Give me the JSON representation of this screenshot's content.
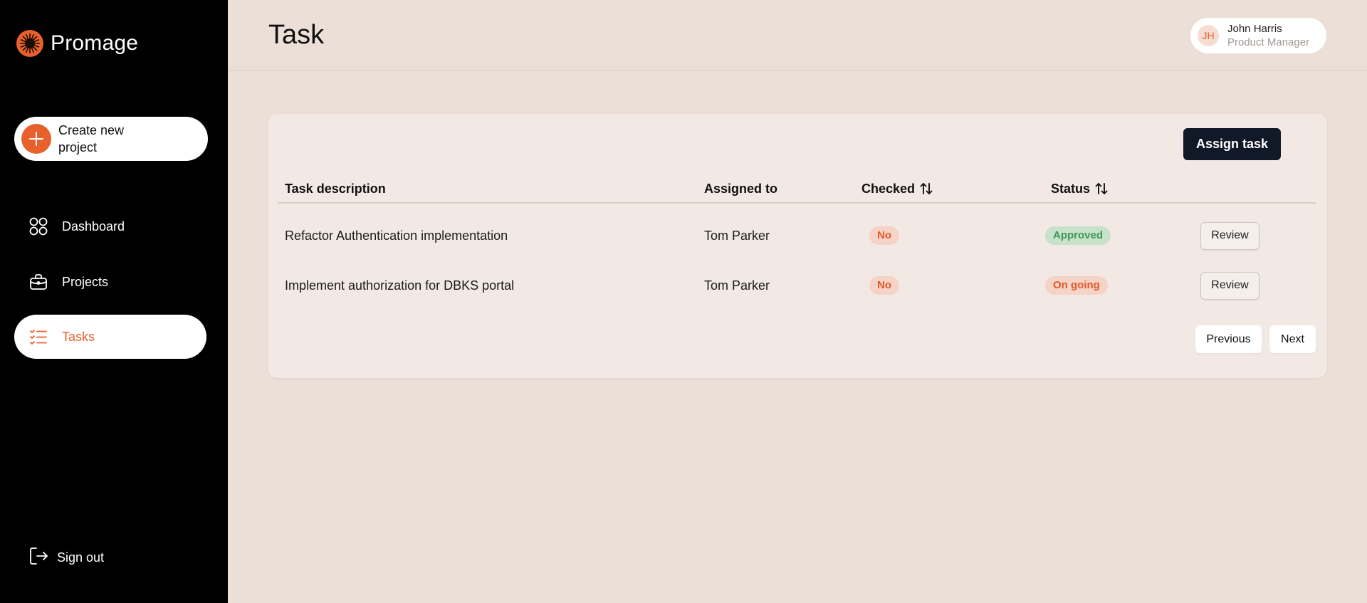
{
  "brand": {
    "name": "Promage",
    "logo_icon": "sunburst-logo",
    "accent": "#e8602c"
  },
  "sidebar": {
    "create_button": {
      "label": "Create new project",
      "icon": "plus-icon"
    },
    "items": [
      {
        "label": "Dashboard",
        "icon": "grid-icon",
        "active": false
      },
      {
        "label": "Projects",
        "icon": "briefcase-icon",
        "active": false
      },
      {
        "label": "Tasks",
        "icon": "checklist-icon",
        "active": true
      }
    ],
    "signout": {
      "label": "Sign out",
      "icon": "logout-icon"
    }
  },
  "header": {
    "title": "Task",
    "user": {
      "initials": "JH",
      "name": "John Harris",
      "role": "Product Manager"
    }
  },
  "tasks": {
    "assign_button": "Assign task",
    "columns": [
      "Task description",
      "Assigned to",
      "Checked",
      "Status"
    ],
    "rows": [
      {
        "description": "Refactor Authentication implementation",
        "assigned_to": "Tom Parker",
        "checked": "No",
        "status": "Approved",
        "action": "Review"
      },
      {
        "description": "Implement authorization for DBKS portal",
        "assigned_to": "Tom Parker",
        "checked": "No",
        "status": "On going",
        "action": "Review"
      }
    ],
    "pagination": {
      "previous": "Previous",
      "next": "Next"
    }
  },
  "colors": {
    "sidebar_bg": "#000000",
    "page_bg": "#ecdfd7",
    "card_bg": "#f2e9e4",
    "primary_button": "#111827",
    "approved": "#3c9a54",
    "pending": "#e2582a"
  }
}
